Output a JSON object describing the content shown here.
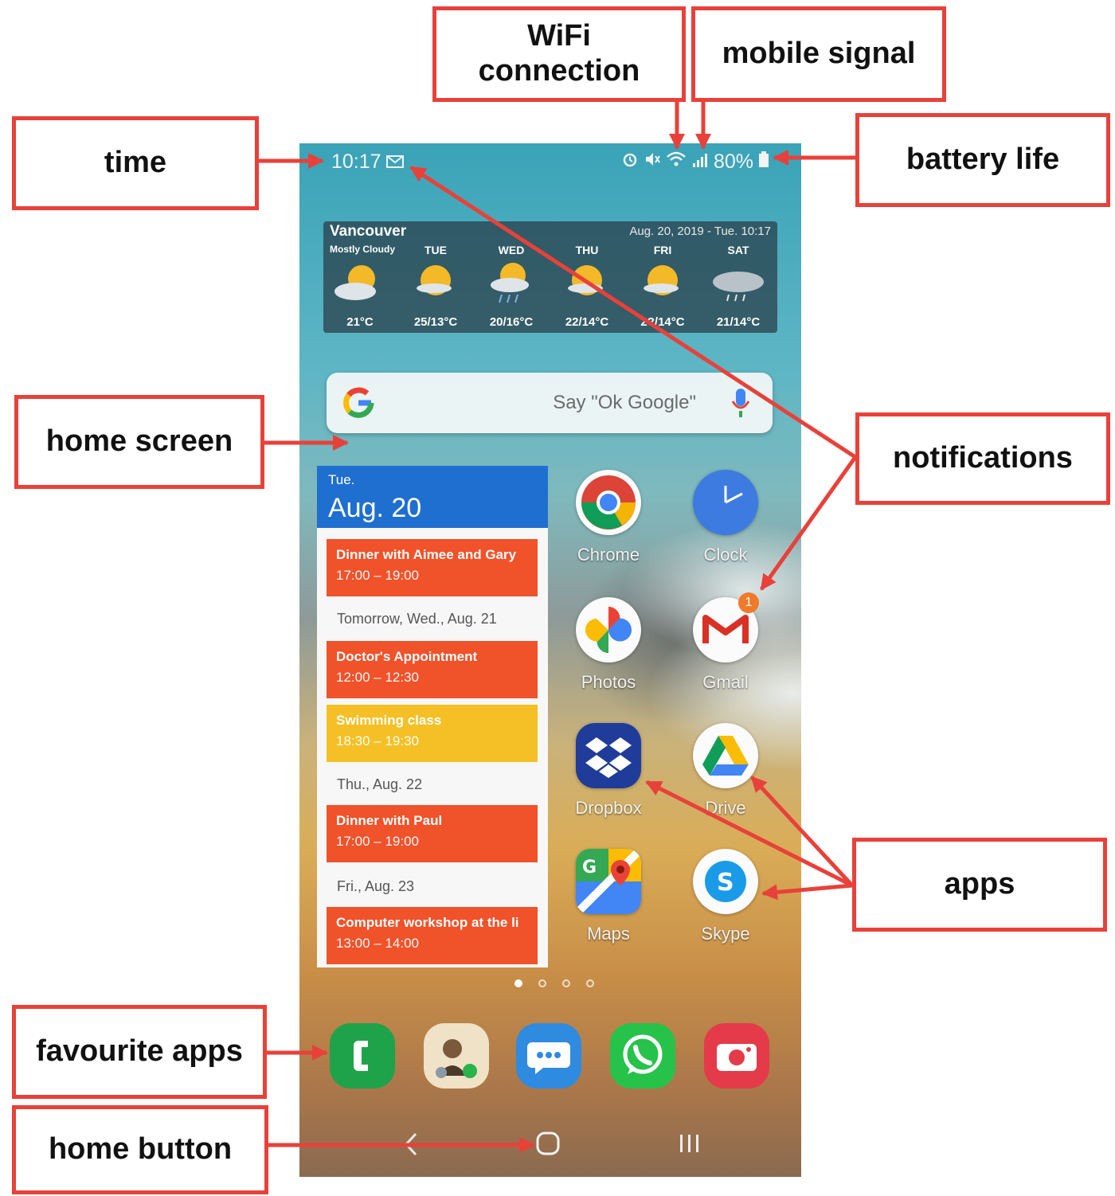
{
  "callouts": {
    "wifi": "WiFi\nconnection",
    "mobile": "mobile signal",
    "time": "time",
    "battery": "battery life",
    "home_screen": "home screen",
    "notifications": "notifications",
    "apps": "apps",
    "favourite": "favourite apps",
    "home_button": "home button"
  },
  "status": {
    "time": "10:17",
    "battery": "80%"
  },
  "weather": {
    "city": "Vancouver",
    "condition": "Mostly Cloudy",
    "datetime": "Aug. 20, 2019 - Tue. 10:17",
    "days": [
      {
        "day": "",
        "temp": "21°C",
        "icon": "sun-cloud-icon"
      },
      {
        "day": "TUE",
        "temp": "25/13°C",
        "icon": "sun-cloud-icon"
      },
      {
        "day": "WED",
        "temp": "20/16°C",
        "icon": "rain-icon"
      },
      {
        "day": "THU",
        "temp": "22/14°C",
        "icon": "sun-cloud-icon"
      },
      {
        "day": "FRI",
        "temp": "2?/14°C",
        "icon": "sun-cloud-icon"
      },
      {
        "day": "SAT",
        "temp": "21/14°C",
        "icon": "cloud-rain-icon"
      }
    ]
  },
  "search": {
    "hint": "Say \"Ok Google\""
  },
  "calendar": {
    "dow": "Tue.",
    "date": "Aug. 20",
    "events": [
      {
        "title": "Dinner with Aimee and Gary",
        "time": "17:00 – 19:00",
        "color": "#f0522a"
      },
      {
        "title": "Doctor's Appointment",
        "time": "12:00 – 12:30",
        "color": "#f0522a"
      },
      {
        "title": "Swimming class",
        "time": "18:30 – 19:30",
        "color": "#f4c025"
      },
      {
        "title": "Dinner with Paul",
        "time": "17:00 – 19:00",
        "color": "#f0522a"
      },
      {
        "title": "Computer workshop at the li",
        "time": "13:00 – 14:00",
        "color": "#f0522a"
      }
    ],
    "day_labels": [
      "Tomorrow, Wed., Aug. 21",
      "Thu., Aug. 22",
      "Fri., Aug. 23"
    ]
  },
  "apps": {
    "chrome": "Chrome",
    "clock": "Clock",
    "photos": "Photos",
    "gmail": "Gmail",
    "gmail_badge": "1",
    "dropbox": "Dropbox",
    "drive": "Drive",
    "maps": "Maps",
    "skype": "Skype"
  },
  "colors": {
    "annotation": "#e8413a",
    "calendar_header": "#1f6fd0"
  }
}
